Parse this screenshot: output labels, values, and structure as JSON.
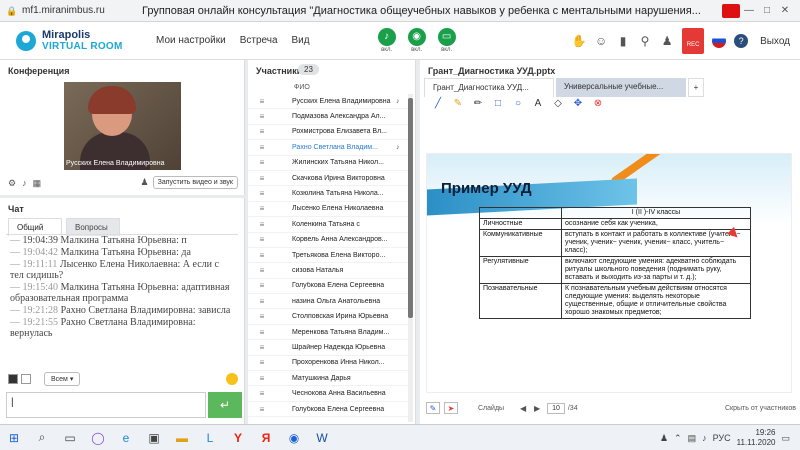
{
  "browser": {
    "url": "mf1.miranimbus.ru",
    "title": "Групповая онлайн консультация \"Диагностика общеучебных навыков у ребенка с ментальными нарушения...",
    "buttons": [
      "—",
      "□",
      "✕"
    ]
  },
  "header": {
    "logo_line1": "Mirapolis",
    "logo_line2": "VIRTUAL ROOM",
    "nav": [
      "Мои настройки",
      "Встреча",
      "Вид"
    ],
    "controls": [
      {
        "label": "вкл.",
        "icon": "microphone-icon"
      },
      {
        "label": "вкл.",
        "icon": "camera-icon"
      },
      {
        "label": "вкл.",
        "icon": "screen-icon"
      }
    ],
    "rec_label": "REC",
    "exit_label": "Выход",
    "help_label": "?"
  },
  "conference": {
    "title": "Конференция",
    "speaker_name": "Русских Елена Владимировна",
    "launch_label": "Запустить видео и звук"
  },
  "chat": {
    "title": "Чат",
    "tabs": [
      "Общий",
      "Вопросы"
    ],
    "top_partial": "19:04:39 Малкина Татьяна Юрьевна: п",
    "messages": [
      {
        "time": "19:04:42",
        "text": "Малкина Татьяна Юрьевна: да"
      },
      {
        "time": "19:11:11",
        "text": "Лысенко Елена Николаевна: А если с тел сидишь?"
      },
      {
        "time": "19:15:40",
        "text": "Малкина Татьяна Юрьевна: адаптивная образовательная программа"
      },
      {
        "time": "19:21:28",
        "text": "Рахно Светлана Владимировна: зависла"
      },
      {
        "time": "19:21:55",
        "text": "Рахно Светлана Владимировна: вернулась"
      }
    ],
    "recipient": "Всем",
    "send_icon": "↵"
  },
  "participants": {
    "title": "Участники",
    "count": "23",
    "column_header": "ФИО",
    "list": [
      "Русских Елена Владимировна",
      "Подмазова Александра Ал...",
      "Рохмистрова Елизавета Вл...",
      "Рахно Светлана Владим...",
      "Жилинских Татьяна Никол...",
      "Скачкова Ирина Викторовна",
      "Козюлина Татьяна Никола...",
      "Лысенко Елена Николаевна",
      "Коленкина Татьяна с",
      "Корвель Анна Александров...",
      "Третьякова Елена Викторо...",
      "сизова Наталья",
      "Голубкова Елена Сергеевна",
      "назина Ольга Анатольевна",
      "Столповская Ирина Юрьевна",
      "Меренкова Татьяна Владим...",
      "Шрайнер Надежда Юрьевна",
      "Прохоренкова Инна Никол...",
      "Матушкина Дарья",
      "Чеснокова Анна Васильевна",
      "Голубкова Елена Сергеевна"
    ],
    "highlighted_index": 3
  },
  "presentation": {
    "title": "Грант_Диагностика УУД.pptx",
    "tabs": [
      "Грант_Диагностика УУД...",
      "Универсальные учебные..."
    ],
    "plus_label": "+",
    "slide": {
      "title": "Пример УУД",
      "header_right": "I (II )-IV классы",
      "rows": [
        {
          "k": "Личностные",
          "v": "осознание себя как ученика,"
        },
        {
          "k": "Коммуникативные",
          "v": "вступать в контакт и работать в коллективе (учитель− ученик, ученик− ученик, ученик− класс, учитель− класс);"
        },
        {
          "k": "Регулятивные",
          "v": "включают следующие умения: адекватно соблюдать ритуалы школьного поведения (поднимать руку, вставать и выходить из-за парты и т. д.);"
        },
        {
          "k": "Познавательные",
          "v": "К познавательным учебным действиям относятся следующие умения: выделять некоторые существенные, общие и отличительные свойства хорошо знакомых предметов;"
        }
      ]
    },
    "footer": {
      "slides_label": "Слайды",
      "page": "10",
      "total": "/34",
      "hide_label": "Скрыть от участников"
    }
  },
  "taskbar": {
    "time": "19:26",
    "date": "11.11.2020",
    "lang": "РУС"
  }
}
